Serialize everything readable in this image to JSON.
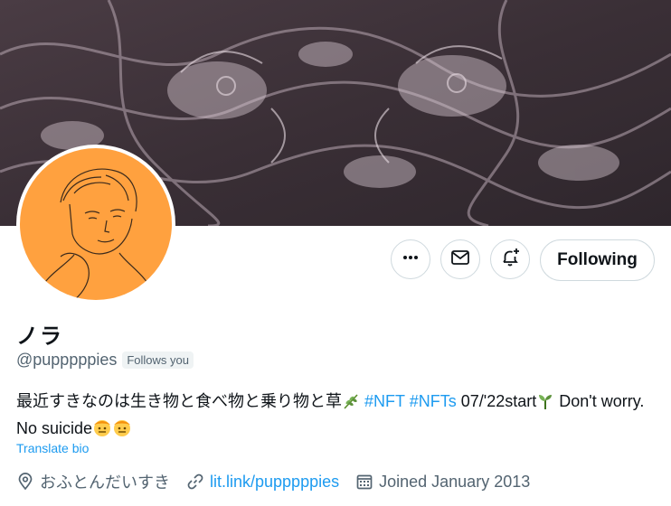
{
  "profile": {
    "display_name": "ノラ",
    "handle": "@pupppppies",
    "follows_you": "Follows you",
    "bio": {
      "text_1": "最近すきなのは生き物と食べ物と乗り物と草",
      "hashtag_1": "#NFT",
      "hashtag_2": "#NFTs",
      "text_2": "07/'22start",
      "text_3": "Don't worry. No suicide"
    },
    "translate_label": "Translate bio",
    "location": "おふとんだいすき",
    "website": "lit.link/pupppppies",
    "joined": "Joined January 2013"
  },
  "actions": {
    "follow_label": "Following"
  },
  "icons": {
    "more": "more-icon",
    "message": "mail-icon",
    "notify": "bell-plus-icon",
    "location": "location-pin-icon",
    "link": "link-icon",
    "calendar": "calendar-icon"
  },
  "colors": {
    "accent": "#1d9bf0",
    "avatar_bg": "#ffa13f",
    "muted": "#536471"
  }
}
